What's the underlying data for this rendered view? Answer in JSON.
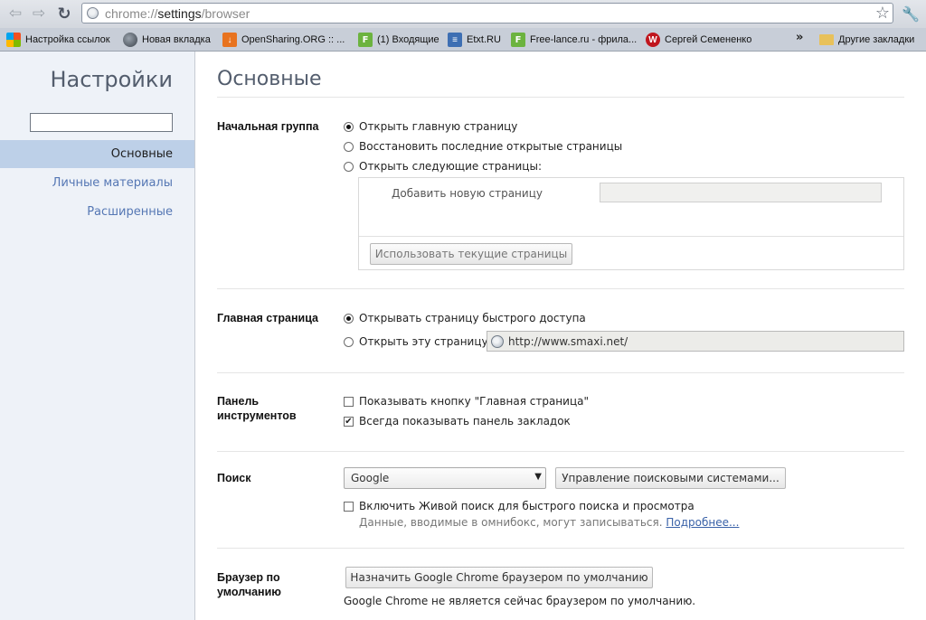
{
  "toolbar": {
    "back_icon": "arrow-left-icon",
    "forward_icon": "arrow-right-icon",
    "reload_icon": "reload-icon",
    "url_scheme": "chrome://",
    "url_host": "settings",
    "url_path": "/browser",
    "bookmark_star_icon": "star-icon",
    "menu_icon": "wrench-icon"
  },
  "bookmarks": {
    "items": [
      {
        "label": "Настройка ссылок",
        "icon": "windows-flag-icon"
      },
      {
        "label": "Новая вкладка",
        "icon": "globe-icon"
      },
      {
        "label": "OpenSharing.ORG :: ...",
        "icon": "download-icon"
      },
      {
        "label": "(1) Входящие",
        "icon": "f-icon"
      },
      {
        "label": "Etxt.RU",
        "icon": "etxt-icon"
      },
      {
        "label": "Free-lance.ru - фрила...",
        "icon": "f-icon"
      },
      {
        "label": "Сергей Семененко",
        "icon": "w-icon"
      }
    ],
    "overflow": "»",
    "other_label": "Другие закладки"
  },
  "sidebar": {
    "title": "Настройки",
    "search_value": "",
    "items": [
      {
        "label": "Основные",
        "active": true
      },
      {
        "label": "Личные материалы",
        "active": false
      },
      {
        "label": "Расширенные",
        "active": false
      }
    ]
  },
  "main": {
    "title": "Основные",
    "startup": {
      "label": "Начальная группа",
      "option_home": "Открыть главную страницу",
      "option_restore": "Восстановить последние открытые страницы",
      "option_pages": "Открыть следующие страницы:",
      "add_page_label": "Добавить новую страницу",
      "use_current_button": "Использовать текущие страницы",
      "selected": "home"
    },
    "homepage": {
      "label": "Главная страница",
      "option_ntp": "Открывать страницу быстрого доступа",
      "option_url": "Открыть эту страницу:",
      "url_value": "http://www.smaxi.net/",
      "selected": "ntp"
    },
    "toolbar_section": {
      "label_line1": "Панель",
      "label_line2": "инструментов",
      "show_home_button": "Показывать кнопку \"Главная страница\"",
      "show_home_checked": false,
      "always_show_bookmarks": "Всегда показывать панель закладок",
      "always_show_bookmarks_checked": true
    },
    "search": {
      "label": "Поиск",
      "engine": "Google",
      "manage_button": "Управление поисковыми системами...",
      "instant": "Включить Живой поиск для быстрого поиска и просмотра",
      "instant_checked": false,
      "hint": "Данные, вводимые в омнибокс, могут записываться.",
      "more_link": "Подробнее..."
    },
    "default_browser": {
      "label_line1": "Браузер по",
      "label_line2": "умолчанию",
      "button": "Назначить Google Chrome браузером по умолчанию",
      "note": "Google Chrome не является сейчас браузером по умолчанию."
    }
  }
}
